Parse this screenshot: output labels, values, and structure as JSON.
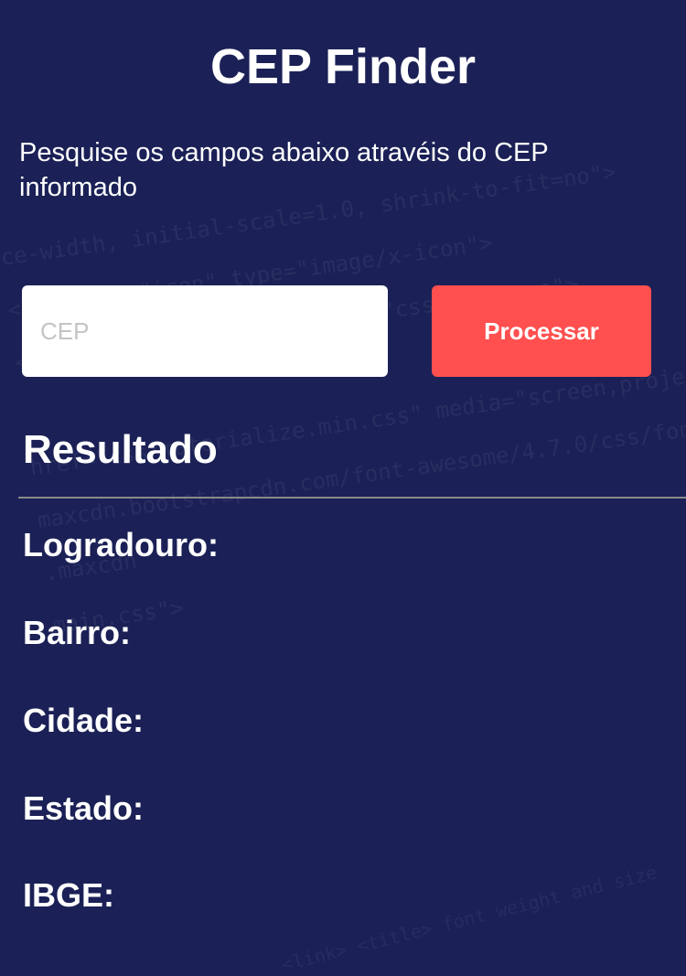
{
  "header": {
    "title": "CEP Finder",
    "subtitle": "Pesquise os campos abaixo atravéis do CEP informado"
  },
  "form": {
    "cep_placeholder": "CEP",
    "cep_value": "",
    "process_label": "Processar"
  },
  "result": {
    "heading": "Resultado",
    "fields": [
      {
        "label": "Logradouro:"
      },
      {
        "label": "Bairro:"
      },
      {
        "label": "Cidade:"
      },
      {
        "label": "Estado:"
      },
      {
        "label": "IBGE:"
      }
    ]
  },
  "colors": {
    "background": "#1b2156",
    "accent": "#ff4f4f",
    "text": "#ffffff"
  }
}
